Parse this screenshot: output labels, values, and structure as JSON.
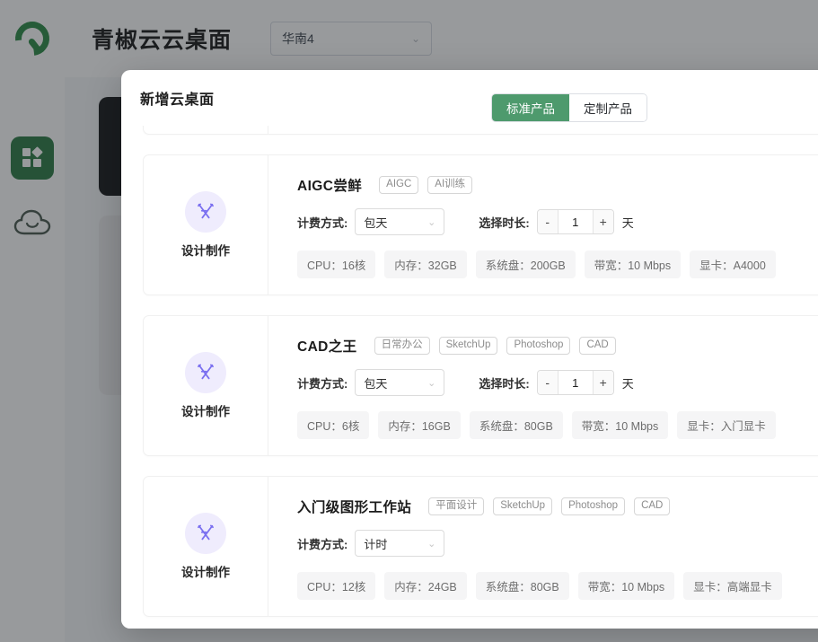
{
  "header": {
    "logo_icon": "qingjiao-q-logo",
    "app_title": "青椒云云桌面",
    "region": {
      "value": "华南4",
      "chevron": "⌄"
    }
  },
  "sidebar": {
    "items": [
      {
        "name": "apps",
        "icon": "grid-apps-icon",
        "active": true
      },
      {
        "name": "cloud",
        "icon": "cloud-icon",
        "active": false
      }
    ]
  },
  "modal": {
    "title": "新增云桌面",
    "type_switch": [
      {
        "label": "标准产品",
        "active": true
      },
      {
        "label": "定制产品",
        "active": false
      }
    ],
    "products": [
      {
        "clipped": true,
        "category": "",
        "category_icon": "",
        "name": "",
        "tags": [],
        "billing_label": "",
        "billing_value": "",
        "duration_label": "",
        "duration_value": "",
        "duration_unit": "",
        "specs": []
      },
      {
        "clipped": false,
        "category": "设计制作",
        "category_icon": "design-tools-icon",
        "name": "AIGC尝鲜",
        "tags": [
          "AIGC",
          "AI训练"
        ],
        "billing_label": "计费方式:",
        "billing_value": "包天",
        "duration_label": "选择时长:",
        "duration_minus": "-",
        "duration_value": "1",
        "duration_plus": "+",
        "duration_unit": "天",
        "specs": [
          "CPU：16核",
          "内存：32GB",
          "系统盘：200GB",
          "带宽：10 Mbps",
          "显卡：A4000"
        ]
      },
      {
        "clipped": false,
        "category": "设计制作",
        "category_icon": "design-tools-icon",
        "name": "CAD之王",
        "tags": [
          "日常办公",
          "SketchUp",
          "Photoshop",
          "CAD"
        ],
        "billing_label": "计费方式:",
        "billing_value": "包天",
        "duration_label": "选择时长:",
        "duration_minus": "-",
        "duration_value": "1",
        "duration_plus": "+",
        "duration_unit": "天",
        "specs": [
          "CPU：6核",
          "内存：16GB",
          "系统盘：80GB",
          "带宽：10 Mbps",
          "显卡：入门显卡"
        ]
      },
      {
        "clipped": false,
        "category": "设计制作",
        "category_icon": "design-tools-icon",
        "name": "入门级图形工作站",
        "tags": [
          "平面设计",
          "SketchUp",
          "Photoshop",
          "CAD"
        ],
        "billing_label": "计费方式:",
        "billing_value": "计时",
        "duration_label": "",
        "duration_minus": "",
        "duration_value": "",
        "duration_plus": "",
        "duration_unit": "",
        "specs": [
          "CPU：12核",
          "内存：24GB",
          "系统盘：80GB",
          "带宽：10 Mbps",
          "显卡：高端显卡"
        ]
      }
    ]
  },
  "colors": {
    "brand_green": "#2d7a45",
    "switch_active": "#4e9a6d",
    "category_purple": "#7a6ff0",
    "overlay": "rgba(30,34,40,0.46)"
  }
}
